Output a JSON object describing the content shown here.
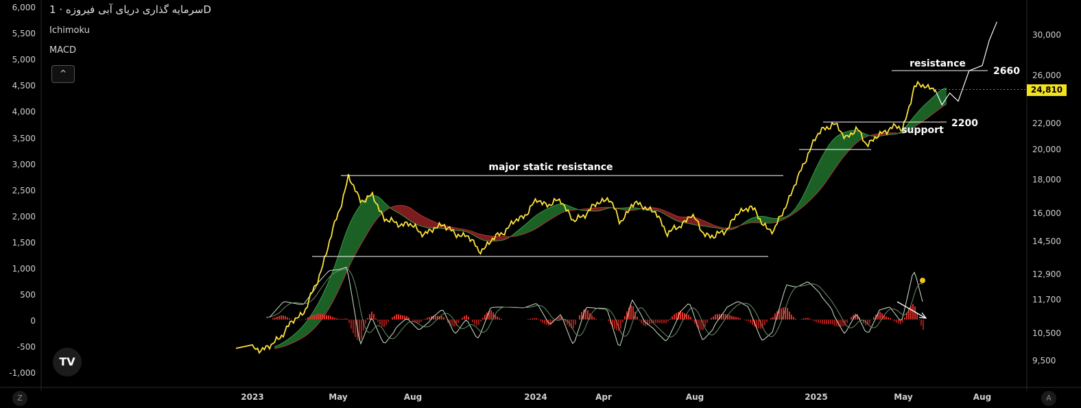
{
  "header": {
    "title": "سرمایه گذاری دریای آبی فیروزه · 1D",
    "indicator_1": "Ichimoku",
    "indicator_2": "MACD",
    "collapse_label": "^"
  },
  "logo_text": "TV",
  "corner_left": "Z",
  "corner_right": "A",
  "current_price_label": "24,810",
  "colors": {
    "price_line": "#ffe53b",
    "cloud_bull": "#1e6b2a",
    "cloud_bear": "#8a1f22",
    "macd_line": "#cfe8cf",
    "signal_line": "#6c8f6c",
    "hist_up": "#e0302a",
    "annotation": "#ffffff",
    "background": "#000000"
  },
  "chart_data": {
    "type": "line",
    "title": "سرمایه گذاری دریای آبی فیروزه · 1D",
    "x_ticks": [
      "2023",
      "May",
      "Aug",
      "2024",
      "Apr",
      "Aug",
      "2025",
      "May",
      "Aug"
    ],
    "left_axis_ticks": [
      "6,000",
      "5,500",
      "5,000",
      "4,500",
      "4,000",
      "3,500",
      "3,000",
      "2,500",
      "2,000",
      "1,500",
      "1,000",
      "500",
      "0",
      "-500",
      "-1,000"
    ],
    "right_axis_ticks": [
      "30,000",
      "26,000",
      "22,000",
      "20,000",
      "18,000",
      "16,000",
      "14,500",
      "12,900",
      "11,700",
      "10,500",
      "9,500"
    ],
    "right_axis_scale": "log",
    "series": [
      {
        "name": "price",
        "x": [
          "2023-01-01",
          "2023-01-25",
          "2023-02-15",
          "2023-03-10",
          "2023-03-25",
          "2023-04-10",
          "2023-04-25",
          "2023-05-05",
          "2023-05-20",
          "2023-06-05",
          "2023-06-20",
          "2023-07-05",
          "2023-07-20",
          "2023-08-05",
          "2023-08-20",
          "2023-09-05",
          "2023-09-20",
          "2023-10-05",
          "2023-10-20",
          "2023-11-05",
          "2023-11-20",
          "2023-12-05",
          "2023-12-20",
          "2024-01-05",
          "2024-01-20",
          "2024-02-05",
          "2024-02-20",
          "2024-03-05",
          "2024-03-20",
          "2024-04-05",
          "2024-04-20",
          "2024-05-05",
          "2024-05-20",
          "2024-06-05",
          "2024-06-20",
          "2024-07-05",
          "2024-07-20",
          "2024-08-05",
          "2024-08-20",
          "2024-09-05",
          "2024-09-20",
          "2024-10-05",
          "2024-10-20",
          "2024-11-05",
          "2024-11-20",
          "2024-12-05",
          "2024-12-20",
          "2025-01-05",
          "2025-01-20",
          "2025-02-05",
          "2025-02-20",
          "2025-03-05",
          "2025-03-20",
          "2025-04-05",
          "2025-04-20",
          "2025-05-05",
          "2025-05-20",
          "2025-06-01"
        ],
        "values": [
          9900,
          10000,
          10700,
          11400,
          12500,
          14400,
          16500,
          18200,
          16800,
          17000,
          15800,
          15400,
          15500,
          15000,
          15000,
          15500,
          14800,
          14900,
          14000,
          14500,
          15000,
          15500,
          16000,
          16800,
          16500,
          16800,
          15500,
          16000,
          16500,
          17000,
          15500,
          16500,
          16500,
          16000,
          15000,
          15200,
          16000,
          15000,
          14700,
          15200,
          16000,
          16500,
          15500,
          15000,
          16500,
          18000,
          20000,
          21500,
          22000,
          21000,
          21500,
          20500,
          21000,
          21800,
          21500,
          25000,
          25200,
          24810
        ]
      },
      {
        "name": "projection",
        "x": [
          "2025-06-01",
          "2025-06-10",
          "2025-06-20",
          "2025-07-01",
          "2025-07-15",
          "2025-08-01",
          "2025-08-10",
          "2025-08-20"
        ],
        "values": [
          24810,
          23500,
          24500,
          23800,
          26500,
          27000,
          29500,
          31500
        ]
      }
    ],
    "annotations": [
      {
        "text": "major static resistance"
      },
      {
        "text": "resistance"
      },
      {
        "text": "2660"
      },
      {
        "text": "support"
      },
      {
        "text": "2200"
      }
    ]
  }
}
